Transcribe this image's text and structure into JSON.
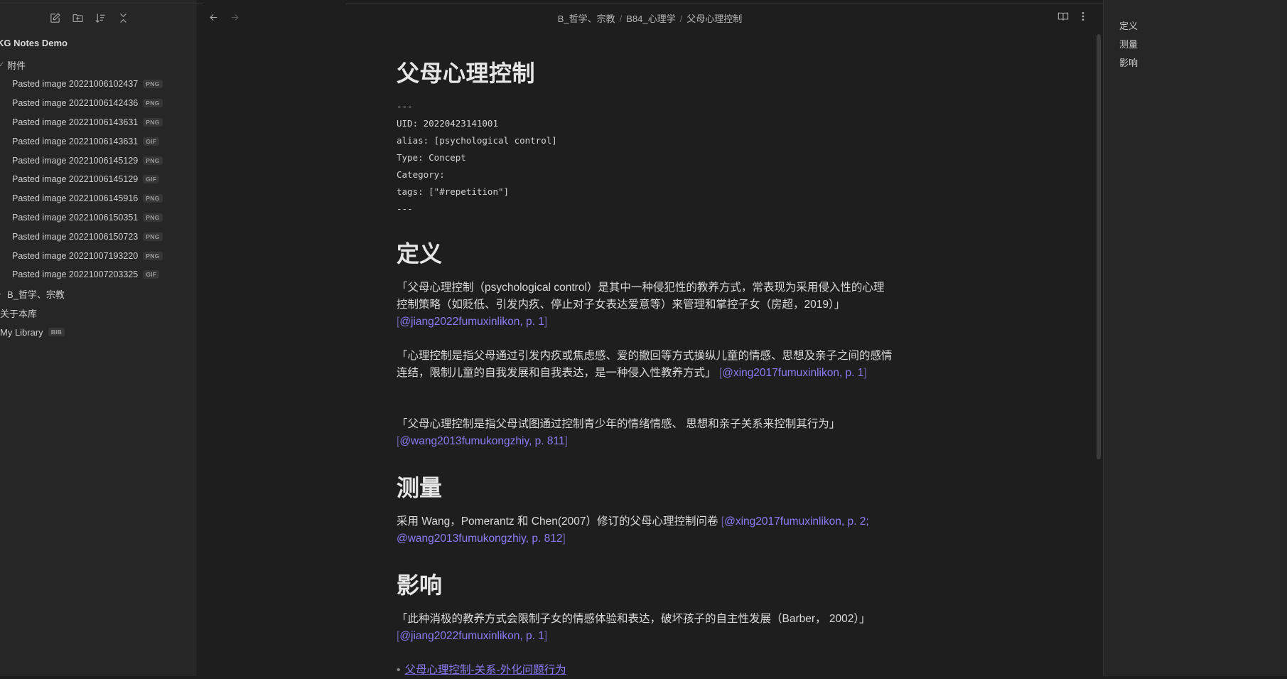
{
  "sidebar": {
    "toolbar": [
      "new-note-icon",
      "new-folder-icon",
      "sort-icon",
      "collapse-all-icon"
    ],
    "vault_name": "KG Notes Demo",
    "attachments_folder": {
      "label": "附件",
      "files": [
        {
          "name": "Pasted image 20221006102437",
          "ext": "PNG"
        },
        {
          "name": "Pasted image 20221006142436",
          "ext": "PNG"
        },
        {
          "name": "Pasted image 20221006143631",
          "ext": "PNG"
        },
        {
          "name": "Pasted image 20221006143631",
          "ext": "GIF"
        },
        {
          "name": "Pasted image 20221006145129",
          "ext": "PNG"
        },
        {
          "name": "Pasted image 20221006145129",
          "ext": "GIF"
        },
        {
          "name": "Pasted image 20221006145916",
          "ext": "PNG"
        },
        {
          "name": "Pasted image 20221006150351",
          "ext": "PNG"
        },
        {
          "name": "Pasted image 20221006150723",
          "ext": "PNG"
        },
        {
          "name": "Pasted image 20221007193220",
          "ext": "PNG"
        },
        {
          "name": "Pasted image 20221007203325",
          "ext": "GIF"
        }
      ]
    },
    "folder_b": "B_哲学、宗教",
    "about": "关于本库",
    "library": {
      "name": "My Library",
      "ext": "BIB"
    }
  },
  "header": {
    "breadcrumb": [
      "B_哲学、宗教",
      "B84_心理学",
      "父母心理控制"
    ]
  },
  "note": {
    "title": "父母心理控制",
    "frontmatter": [
      "---",
      "UID: 20220423141001",
      "alias: [psychological control]",
      "Type: Concept",
      "Category:",
      "tags: [\"#repetition\"]",
      "---"
    ],
    "sections": {
      "definition": {
        "heading": "定义",
        "p1_text": "「父母心理控制（psychological control）是其中一种侵犯性的教养方式，常表现为采用侵入性的心理控制策略（如贬低、引发内疚、停止对子女表达爱意等）来管理和掌控子女（房超，2019）」",
        "p1_cite": "@jiang2022fumuxinlikon, p. 1",
        "p2_text": "「心理控制是指父母通过引发内疚或焦虑感、爱的撤回等方式操纵儿童的情感、思想及亲子之间的感情连结，限制儿童的自我发展和自我表达，是一种侵入性教养方式」",
        "p2_cite": "@xing2017fumuxinlikon, p. 1",
        "p3_text": "「父母心理控制是指父母试图通过控制青少年的情绪情感、 思想和亲子关系来控制其行为」",
        "p3_cite": "@wang2013fumukongzhiy, p. 811"
      },
      "measure": {
        "heading": "测量",
        "p1_text": "采用 Wang，Pomerantz 和 Chen(2007）修订的父母心理控制问卷 ",
        "p1_cite": "@xing2017fumuxinlikon, p. 2; @wang2013fumukongzhiy, p. 812"
      },
      "effect": {
        "heading": "影响",
        "p1_text": "「此种消极的教养方式会限制子女的情感体验和表达，破坏孩子的自主性发展（Barber， 2002）」",
        "p1_cite": "@jiang2022fumuxinlikon, p. 1",
        "link": "父母心理控制-关系-外化问题行为"
      }
    }
  },
  "outline": [
    "定义",
    "测量",
    "影响"
  ],
  "colors": {
    "background": "#1e1e1e",
    "sidebar": "#262626",
    "accent": "#8b7cf6",
    "text": "#dadada"
  }
}
